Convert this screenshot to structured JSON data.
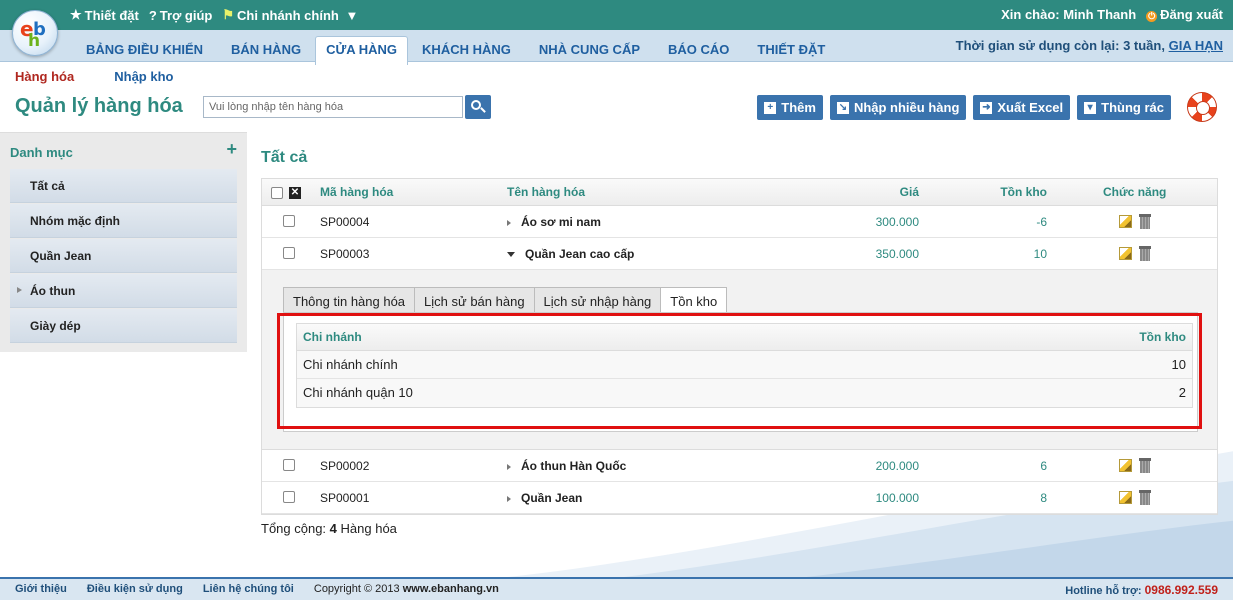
{
  "top": {
    "links": [
      {
        "icon": "star-icon",
        "glyph": "★",
        "label": "Thiết đặt"
      },
      {
        "icon": "help-icon",
        "glyph": "?",
        "label": "Trợ giúp"
      },
      {
        "icon": "branch-icon",
        "glyph": "⚑",
        "label": "Chi nhánh chính"
      }
    ],
    "greeting": "Xin chào: Minh Thanh",
    "logout": "Đăng xuất"
  },
  "nav": {
    "tabs": [
      "BẢNG ĐIỀU KHIỂN",
      "BÁN HÀNG",
      "CỬA HÀNG",
      "KHÁCH HÀNG",
      "NHÀ CUNG CẤP",
      "BÁO CÁO",
      "THIẾT ĐẶT"
    ],
    "active": "CỬA HÀNG",
    "usage_text": "Thời gian sử dụng còn lại: 3 tuần,",
    "extend_link": "GIA HẠN"
  },
  "subnav": {
    "item1": "Hàng hóa",
    "item2": "Nhập kho"
  },
  "page": {
    "title": "Quản lý hàng hóa",
    "search_placeholder": "Vui lòng nhập tên hàng hóa"
  },
  "actions": {
    "add": "Thêm",
    "import_many": "Nhập nhiều hàng",
    "export_excel": "Xuất Excel",
    "trash": "Thùng rác"
  },
  "sidebar": {
    "heading": "Danh mục",
    "plus": "+",
    "items": [
      {
        "label": "Tất cả",
        "has_children": false
      },
      {
        "label": "Nhóm mặc định",
        "has_children": false
      },
      {
        "label": "Quần Jean",
        "has_children": false
      },
      {
        "label": "Áo thun",
        "has_children": true
      },
      {
        "label": "Giày dép",
        "has_children": false
      }
    ]
  },
  "main": {
    "title": "Tất cả",
    "columns": {
      "code": "Mã hàng hóa",
      "name": "Tên hàng hóa",
      "price": "Giá",
      "stock": "Tồn kho",
      "actions": "Chức năng"
    },
    "rows": [
      {
        "code": "SP00004",
        "name": "Áo sơ mi nam",
        "price": "300.000",
        "stock": "-6",
        "expanded": false
      },
      {
        "code": "SP00003",
        "name": "Quần Jean cao cấp",
        "price": "350.000",
        "stock": "10",
        "expanded": true
      },
      {
        "code": "SP00002",
        "name": "Áo thun Hàn Quốc",
        "price": "200.000",
        "stock": "6",
        "expanded": false
      },
      {
        "code": "SP00001",
        "name": "Quần Jean",
        "price": "100.000",
        "stock": "8",
        "expanded": false
      }
    ],
    "detail": {
      "tabs": [
        "Thông tin hàng hóa",
        "Lịch sử bán hàng",
        "Lịch sử nhập hàng",
        "Tồn kho"
      ],
      "active_tab": "Tồn kho",
      "table": {
        "col_branch": "Chi nhánh",
        "col_stock": "Tồn kho",
        "rows": [
          {
            "branch": "Chi nhánh chính",
            "stock": "10"
          },
          {
            "branch": "Chi nhánh quận 10",
            "stock": "2"
          }
        ]
      }
    },
    "total_label": "Tổng cộng:",
    "total_count": "4",
    "total_unit": "Hàng hóa"
  },
  "footer": {
    "links": [
      "Giới thiệu",
      "Điều kiện sử dụng",
      "Liên hệ chúng tôi"
    ],
    "copyright_prefix": "Copyright © 2013",
    "copyright_site": "www.ebanhang.vn",
    "hotline_label": "Hotline hỗ trợ:",
    "hotline_number": "0986.992.559"
  },
  "colors": {
    "primary": "#2e8a80",
    "button": "#3a73ad",
    "highlight": "#e01010"
  }
}
